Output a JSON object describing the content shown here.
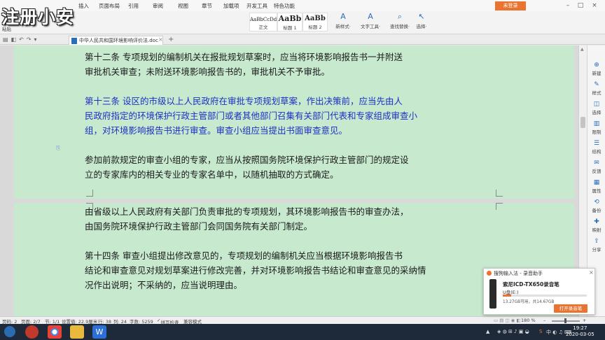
{
  "app": {
    "watermark": "注册小安",
    "login_label": "未登录"
  },
  "menubar": {
    "items": [
      "插入",
      "页面布局",
      "引用",
      "审阅",
      "视图",
      "章节",
      "加载项",
      "开发工具",
      "特色功能"
    ]
  },
  "ribbon": {
    "left_label": "粘贴",
    "styles": [
      {
        "sample": "AaBbCcDd",
        "name": "正文"
      },
      {
        "sample": "AaBb",
        "name": "标题 1"
      },
      {
        "sample": "AaBb",
        "name": "标题 2"
      }
    ],
    "tools": [
      {
        "icon": "new-style-icon",
        "glyph": "A",
        "label": "新样式·"
      },
      {
        "icon": "text-tools-icon",
        "glyph": "A",
        "label": "文字工具·"
      },
      {
        "icon": "find-replace-icon",
        "glyph": "⌕",
        "label": "查找替换·"
      },
      {
        "icon": "select-icon",
        "glyph": "↖",
        "label": "选择·"
      }
    ]
  },
  "tabbar": {
    "doc_title": "中华人民共和国环境影响评价法.doc"
  },
  "document": {
    "page1_paragraphs": [
      {
        "lines": [
          "第十二条    专项规划的编制机关在报批规划草案时，应当将环境影响报告书一并附送",
          "审批机关审查；未附送环境影响报告书的，审批机关不予审批。"
        ],
        "color": "black"
      },
      {
        "lines": [
          "第十三条    设区的市级以上人民政府在审批专项规划草案，作出决策前，应当先由人",
          "民政府指定的环境保护行政主管部门或者其他部门召集有关部门代表和专家组成审查小",
          "组，对环境影响报告书进行审查。审查小组应当提出书面审查意见。"
        ],
        "color": "blue"
      },
      {
        "lines": [
          "参加前款规定的审查小组的专家，应当从按照国务院环境保护行政主管部门的规定设",
          "立的专家库内的相关专业的专家名单中，以随机抽取的方式确定。"
        ],
        "color": "black"
      }
    ],
    "page2_paragraphs": [
      {
        "lines": [
          "由省级以上人民政府有关部门负责审批的专项规划，其环境影响报告书的审查办法，",
          "由国务院环境保护行政主管部门会同国务院有关部门制定。"
        ],
        "color": "black"
      },
      {
        "lines": [
          "第十四条    审查小组提出修改意见的，专项规划的编制机关应当根据环境影响报告书",
          "结论和审查意见对规划草案进行修改完善，并对环境影响报告书结论和审查意见的采纳情",
          "况作出说明；不采纳的，应当说明理由。"
        ],
        "color": "black"
      }
    ]
  },
  "right_panel": {
    "items": [
      {
        "icon": "new-icon",
        "label": "新建"
      },
      {
        "icon": "style-icon",
        "label": "样式"
      },
      {
        "icon": "select-icon",
        "label": "选择"
      },
      {
        "icon": "limit-icon",
        "label": "限制"
      },
      {
        "icon": "structure-icon",
        "label": "结构"
      },
      {
        "icon": "feedback-icon",
        "label": "反馈"
      },
      {
        "icon": "property-icon",
        "label": "属性"
      },
      {
        "icon": "backup-icon",
        "label": "备份"
      },
      {
        "icon": "shortcut-icon",
        "label": "映射"
      },
      {
        "icon": "share-icon",
        "label": "分享"
      }
    ]
  },
  "statusbar": {
    "page": "页码: 2",
    "pages": "页面: 2/7",
    "section": "节: 1/1",
    "position": "设置值: 22.9厘米",
    "row": "行: 38",
    "col": "列: 24",
    "words": "字数: 5259",
    "spell": "拼写检查",
    "compat": "兼容模式",
    "zoom": "180 %"
  },
  "popup": {
    "title": "搜狗输入法 - 录音助手",
    "close": "×",
    "product": "索尼ICD-TX650录音笔",
    "disk": "U盘(E:)",
    "capacity": "13.27GB可用，共14.67GB",
    "used_fraction": 0.1,
    "open_label": "打开录音笔"
  },
  "taskbar": {
    "time": "19:27",
    "date": "2020-03-05"
  },
  "colors": {
    "page_bg": "#c7e9ce",
    "blue_text": "#1d2fc4",
    "accent": "#e9732f"
  }
}
